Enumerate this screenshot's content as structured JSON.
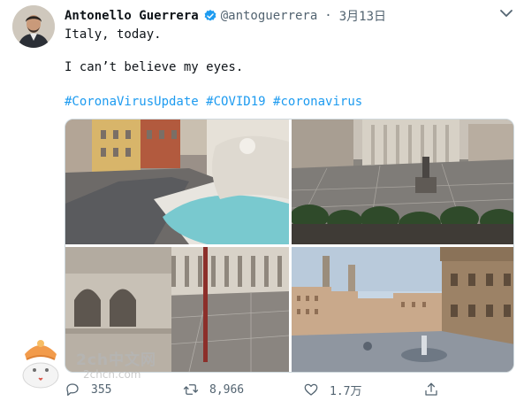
{
  "tweet": {
    "author_name": "Antonello Guerrera",
    "handle": "@antoguerrera",
    "separator": "·",
    "date": "3月13日",
    "lines": [
      "Italy, today.",
      "I can’t believe my eyes."
    ],
    "hashtags": [
      "#CoronaVirusUpdate",
      "#COVID19",
      "#coronavirus"
    ],
    "photos": [
      {
        "subject": "trevi-fountain"
      },
      {
        "subject": "milan-duomo-square"
      },
      {
        "subject": "venice-st-marks-square"
      },
      {
        "subject": "florence-piazza-della-signoria"
      }
    ]
  },
  "actions": {
    "replies": "355",
    "retweets": "8,966",
    "likes": "1.7万"
  },
  "icons": {
    "verified": "verified-badge-icon",
    "caret": "chevron-down-icon",
    "reply": "reply-icon",
    "retweet": "retweet-icon",
    "like": "heart-icon",
    "share": "share-icon"
  },
  "colors": {
    "accent": "#1d9bf0",
    "muted": "#536471",
    "text": "#0f1419",
    "verified": "#1d9bf0"
  },
  "watermark": {
    "text": "2ch中文网",
    "sub": "2chcn.com"
  }
}
